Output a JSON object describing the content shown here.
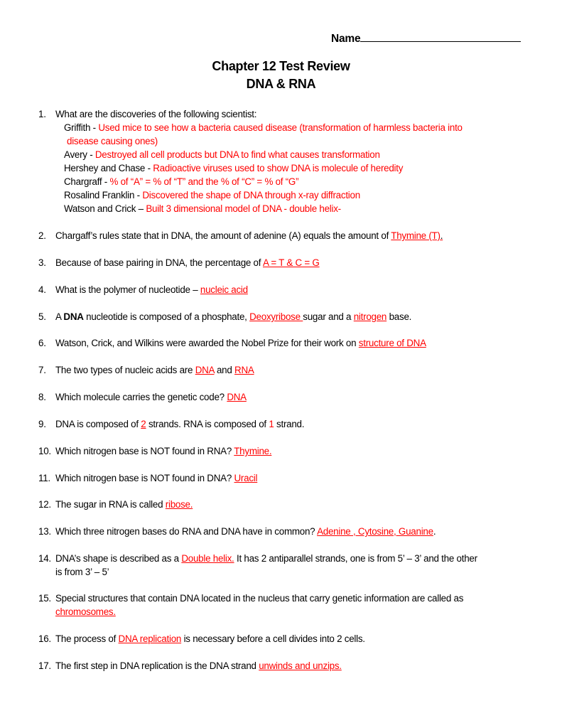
{
  "header": {
    "name_label": "Name",
    "title": "Chapter 12 Test Review",
    "subtitle": "DNA & RNA"
  },
  "colors": {
    "answer": "#ff0000",
    "text": "#000000"
  },
  "q1": {
    "num": "1.",
    "prompt": "What are the discoveries of the following scientist:",
    "scientists": [
      {
        "name": "Griffith - ",
        "answer": "Used mice to see how a bacteria caused disease (transformation of harmless bacteria into",
        "answer_cont": "disease causing ones)"
      },
      {
        "name": "Avery - ",
        "answer": "Destroyed all cell products but DNA to find what causes transformation"
      },
      {
        "name": "Hershey and Chase - ",
        "answer": "Radioactive viruses used to show DNA is molecule of heredity"
      },
      {
        "name": "Chargraff - ",
        "answer": "% of “A” = % of “T” and the % of “C” = % of “G”"
      },
      {
        "name": "Rosalind Franklin - ",
        "answer": "Discovered the shape of DNA through x-ray diffraction"
      },
      {
        "name": "Watson and Crick – ",
        "answer": "Built  3 dimensional model of DNA - double helix-"
      }
    ]
  },
  "questions": {
    "q2": {
      "num": "2.",
      "pre": "Chargaff’s rules state that in DNA, the amount of adenine (A) equals the amount of ",
      "ans": "Thymine (T)",
      "post": "."
    },
    "q3": {
      "num": "3.",
      "pre": "Because of base pairing in DNA, the percentage of ",
      "ans": "A = T & C =  G"
    },
    "q4": {
      "num": "4.",
      "pre": "What is the polymer of nucleotide – ",
      "ans": "nucleic acid"
    },
    "q5": {
      "num": "5.",
      "pre_a": "A ",
      "bold": "DNA",
      "pre_b": " nucleotide is composed of a phosphate, ",
      "ans1": "Deoxyribose ",
      "mid": "sugar and a ",
      "ans2": "nitrogen",
      "post": " base."
    },
    "q6": {
      "num": "6.",
      "pre": "Watson, Crick, and Wilkins were awarded the Nobel Prize for their work on ",
      "ans": "structure of DNA"
    },
    "q7": {
      "num": "7.",
      "pre": "The two types of nucleic acids are ",
      "ans1": "DNA",
      "mid": " and ",
      "ans2": "RNA"
    },
    "q8": {
      "num": "8.",
      "pre": "Which molecule carries the genetic code? ",
      "ans": "DNA"
    },
    "q9": {
      "num": "9.",
      "pre": "DNA is composed of ",
      "ans1": "2",
      "mid": " strands. RNA is composed of ",
      "ans2": "1",
      "post": " strand."
    },
    "q10": {
      "num": "10.",
      "pre": "Which nitrogen base is NOT found in RNA? ",
      "ans": "Thymine."
    },
    "q11": {
      "num": "11.",
      "pre": "Which nitrogen base is NOT found in DNA? ",
      "ans": "Uracil"
    },
    "q12": {
      "num": "12.",
      "pre": "The sugar in RNA is called ",
      "ans": "ribose."
    },
    "q13": {
      "num": "13.",
      "pre": "Which three nitrogen bases do RNA and DNA have in common? ",
      "ans": "Adenine , Cytosine, Guanine",
      "post": "."
    },
    "q14": {
      "num": "14.",
      "pre": "DNA’s shape is described as a ",
      "ans": "Double helix.",
      "post": "  It has 2 antiparallel strands, one is from 5’ – 3’ and the other",
      "cont": "is from 3’ – 5’"
    },
    "q15": {
      "num": "15.",
      "pre": "Special structures that contain DNA located in the nucleus that carry genetic information are called as",
      "ans": "chromosomes."
    },
    "q16": {
      "num": "16.",
      "pre": "The process of ",
      "ans": "DNA replication",
      "post": " is necessary before a cell divides into 2 cells."
    },
    "q17": {
      "num": "17.",
      "pre": "The first step in DNA replication is the DNA strand ",
      "ans": "unwinds and unzips."
    }
  }
}
